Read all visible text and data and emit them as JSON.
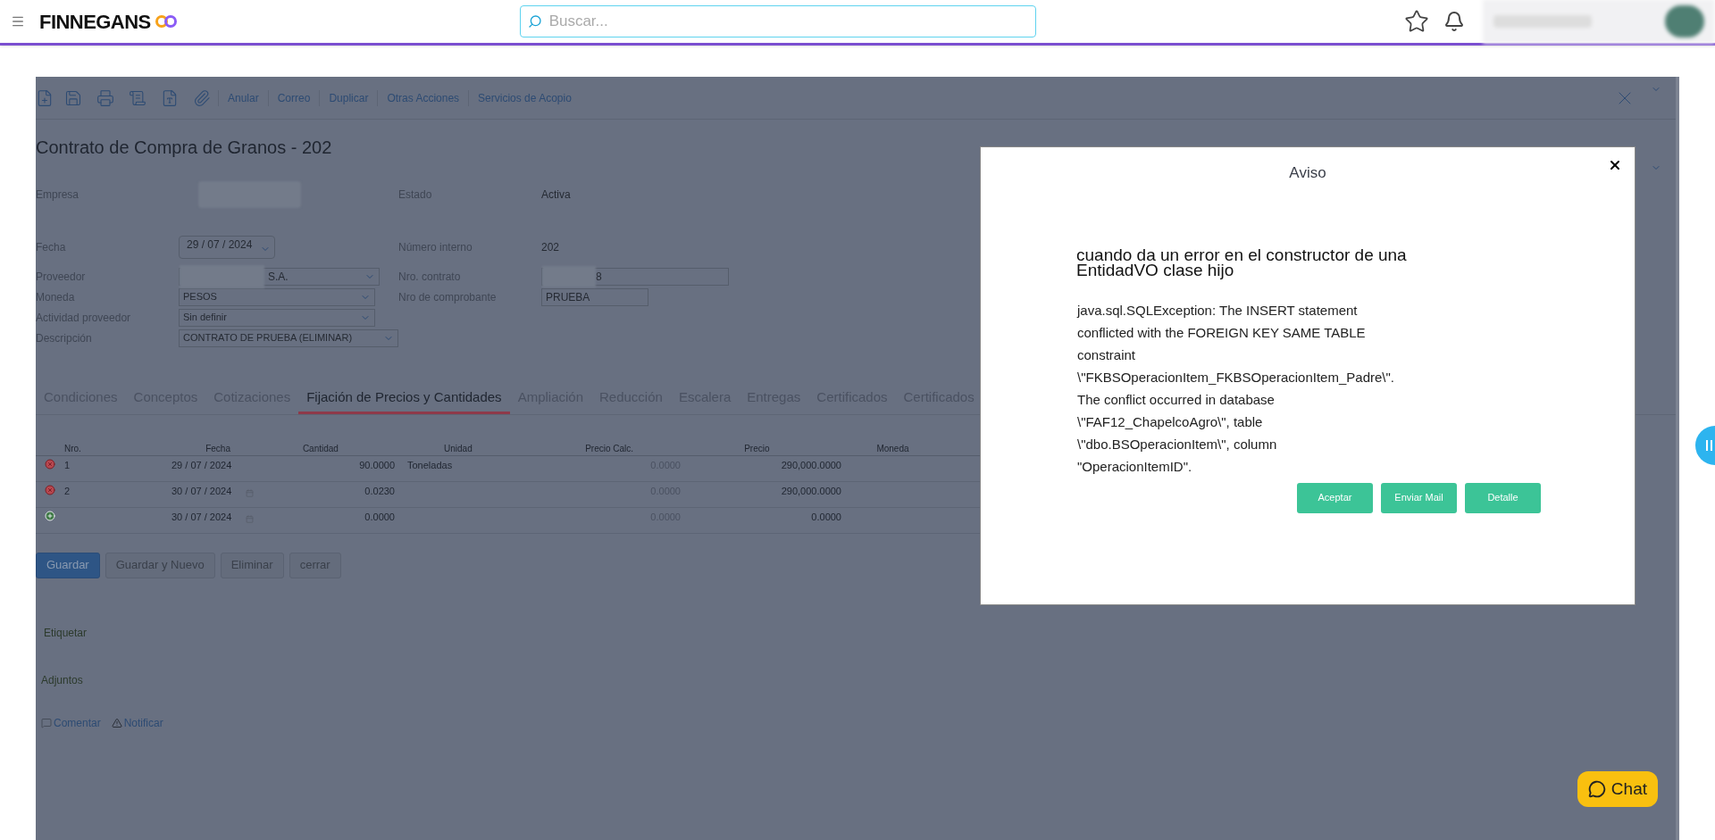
{
  "header": {
    "logo": "FINNEGANS",
    "search": {
      "placeholder": "Buscar..."
    }
  },
  "toolbar": {
    "actions": [
      "Anular",
      "Correo",
      "Duplicar",
      "Otras Acciones",
      "Servicios de Acopio"
    ]
  },
  "form": {
    "title": "Contrato de Compra de Granos - 202",
    "rows": [
      [
        {
          "label": "Empresa",
          "kind": "blurred"
        },
        {
          "label": "Estado",
          "kind": "text",
          "value": "Activa"
        }
      ],
      [
        {
          "label": "Fecha",
          "kind": "date",
          "value": "29 / 07 /  2024"
        },
        {
          "label": "Número interno",
          "kind": "text",
          "value": "202"
        }
      ],
      [
        {
          "label": "Proveedor",
          "kind": "select-blurred",
          "value": "S.A."
        },
        {
          "label": "Nro. contrato",
          "kind": "input-blurred",
          "value": "8"
        }
      ],
      [
        {
          "label": "Moneda",
          "kind": "select",
          "value": "PESOS"
        },
        {
          "label": "Nro de comprobante",
          "kind": "input",
          "value": "PRUEBA"
        }
      ],
      [
        {
          "label": "Actividad proveedor",
          "kind": "select",
          "value": "Sin definir"
        }
      ],
      [
        {
          "label": "Descripción",
          "kind": "select-wide",
          "value": "CONTRATO DE PRUEBA (ELIMINAR)"
        }
      ]
    ]
  },
  "tabs": [
    {
      "label": "Condiciones",
      "selected": false
    },
    {
      "label": "Conceptos",
      "selected": false
    },
    {
      "label": "Cotizaciones",
      "selected": false
    },
    {
      "label": "Fijación de Precios y Cantidades",
      "selected": true
    },
    {
      "label": "Ampliación",
      "selected": false
    },
    {
      "label": "Reducción",
      "selected": false
    },
    {
      "label": "Escalera",
      "selected": false
    },
    {
      "label": "Entregas",
      "selected": false
    },
    {
      "label": "Certificados",
      "selected": false
    },
    {
      "label": "Certificados",
      "selected": false
    }
  ],
  "table": {
    "columns": [
      "Nro.",
      "Fecha",
      "Cantidad",
      "Unidad",
      "Precio Calc.",
      "Precio",
      "Moneda"
    ],
    "rows": [
      {
        "kind": "delete",
        "nro": "1",
        "fecha": "29 / 07 /  2024",
        "calendar": false,
        "cantidad": "90.0000",
        "unidad": "Toneladas",
        "precio_calc": "0.0000",
        "precio": "290,000.0000"
      },
      {
        "kind": "delete",
        "nro": "2",
        "fecha": "30 / 07 /  2024",
        "calendar": true,
        "cantidad": "0.0230",
        "precio_calc": "0.0000",
        "precio": "290,000.0000"
      },
      {
        "kind": "add",
        "fecha": "30 / 07 /  2024",
        "calendar": true,
        "cantidad": "0.0000",
        "precio_calc": "0.0000",
        "precio": "0.0000"
      }
    ]
  },
  "buttons": [
    {
      "label": "Guardar",
      "kind": "primary"
    },
    {
      "label": "Guardar y Nuevo",
      "kind": "default"
    },
    {
      "label": "Eliminar",
      "kind": "default"
    },
    {
      "label": "cerrar",
      "kind": "default"
    }
  ],
  "footer": {
    "tag": "Etiquetar",
    "attachments": "Adjuntos",
    "comment": "Comentar",
    "notify": "Notificar"
  },
  "dialog": {
    "title": "Aviso",
    "heading": "cuando da un error en el constructor de una EntidadVO clase hijo",
    "message": [
      "java.sql.SQLException: The INSERT statement",
      "conflicted with the FOREIGN KEY SAME TABLE",
      "constraint",
      "\\\"FKBSOperacionItem_FKBSOperacionItem_Padre\\\".",
      "The conflict occurred in database",
      "\\\"FAF12_ChapelcoAgro\\\", table",
      "\\\"dbo.BSOperacionItem\\\", column",
      "\"OperacionItemID\"."
    ],
    "buttons": [
      "Aceptar",
      "Enviar Mail",
      "Detalle"
    ]
  },
  "chat": {
    "label": "Chat"
  }
}
